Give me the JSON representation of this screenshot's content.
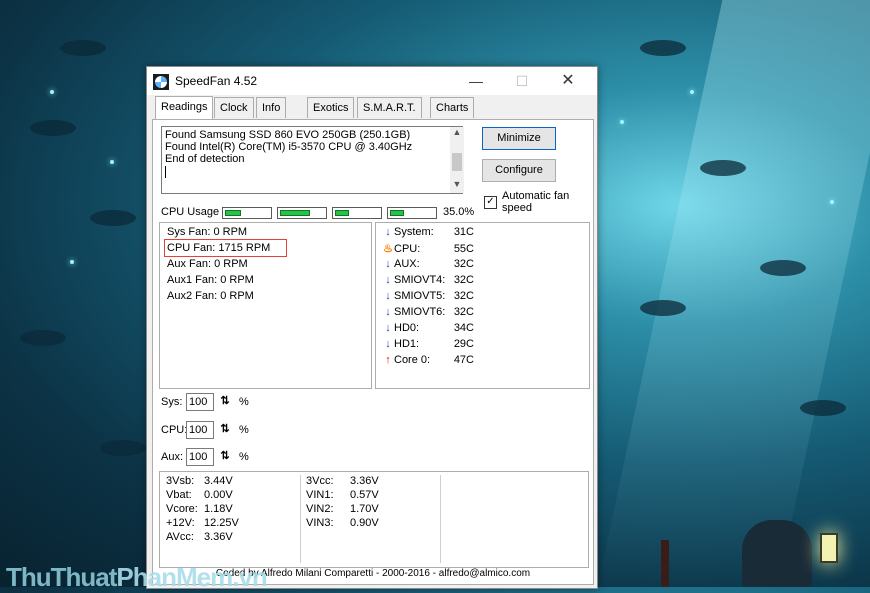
{
  "window": {
    "title": "SpeedFan 4.52",
    "controls": {
      "minimize": "—",
      "maximize": "☐",
      "close": "✕"
    }
  },
  "tabs": [
    "Readings",
    "Clock",
    "Info",
    "Exotics",
    "S.M.A.R.T.",
    "Charts"
  ],
  "log": {
    "lines": [
      "Found Samsung SSD 860 EVO 250GB (250.1GB)",
      "Found Intel(R) Core(TM) i5-3570 CPU @ 3.40GHz",
      "End of detection"
    ]
  },
  "buttons": {
    "minimize": "Minimize",
    "configure": "Configure"
  },
  "auto_fan": {
    "label_line1": "Automatic fan",
    "label_line2": "speed",
    "checked": true,
    "check_glyph": "✓"
  },
  "cpu_usage": {
    "label": "CPU Usage",
    "total": "35.0%",
    "core_levels": [
      0.35,
      0.7,
      0.3,
      0.3
    ]
  },
  "fans": [
    "Sys Fan:  0 RPM",
    "CPU Fan: 1715 RPM",
    "Aux Fan:  0 RPM",
    "Aux1 Fan: 0 RPM",
    "Aux2 Fan: 0 RPM"
  ],
  "temps": [
    {
      "icon": "arrow-down-icon",
      "glyph": "↓",
      "name": "System:",
      "value": "31C"
    },
    {
      "icon": "flame-icon",
      "glyph": "♨",
      "name": "CPU:",
      "value": "55C"
    },
    {
      "icon": "arrow-down-icon",
      "glyph": "↓",
      "name": "AUX:",
      "value": "32C"
    },
    {
      "icon": "arrow-down-icon",
      "glyph": "↓",
      "name": "SMIOVT4:",
      "value": "32C"
    },
    {
      "icon": "arrow-down-icon",
      "glyph": "↓",
      "name": "SMIOVT5:",
      "value": "32C"
    },
    {
      "icon": "arrow-down-icon",
      "glyph": "↓",
      "name": "SMIOVT6:",
      "value": "32C"
    },
    {
      "icon": "arrow-down-icon",
      "glyph": "↓",
      "name": "HD0:",
      "value": "34C"
    },
    {
      "icon": "arrow-down-icon",
      "glyph": "↓",
      "name": "HD1:",
      "value": "29C"
    },
    {
      "icon": "arrow-up-icon",
      "glyph": "↑",
      "name": "Core 0:",
      "value": "47C"
    }
  ],
  "speeds": [
    {
      "label": "Sys:",
      "value": "100",
      "unit": "%",
      "spin_glyph": "⇅"
    },
    {
      "label": "CPU:",
      "value": "100",
      "unit": "%",
      "spin_glyph": "⇅"
    },
    {
      "label": "Aux:",
      "value": "100",
      "unit": "%",
      "spin_glyph": "⇅"
    }
  ],
  "voltages": {
    "col1": [
      {
        "label": "3Vsb:",
        "value": "3.44V"
      },
      {
        "label": "Vbat:",
        "value": "0.00V"
      },
      {
        "label": "Vcore:",
        "value": "1.18V"
      },
      {
        "label": "+12V:",
        "value": "12.25V"
      },
      {
        "label": "AVcc:",
        "value": "3.36V"
      }
    ],
    "col2": [
      {
        "label": "3Vcc:",
        "value": "3.36V"
      },
      {
        "label": "VIN1:",
        "value": "0.57V"
      },
      {
        "label": "VIN2:",
        "value": "1.70V"
      },
      {
        "label": "VIN3:",
        "value": "0.90V"
      }
    ]
  },
  "status_text": "Coded by Alfredo Milani Comparetti - 2000-2016 - alfredo@almico.com",
  "watermark": {
    "part1": "ThuThuat",
    "part2": "PhanMem.vn"
  },
  "colors": {
    "highlight_box": "#e6423a",
    "cpu_bar_fill": "#26c24a",
    "arrow_down": "#1a3ad4",
    "arrow_up": "#e01010",
    "flame": "#ff7a00"
  }
}
